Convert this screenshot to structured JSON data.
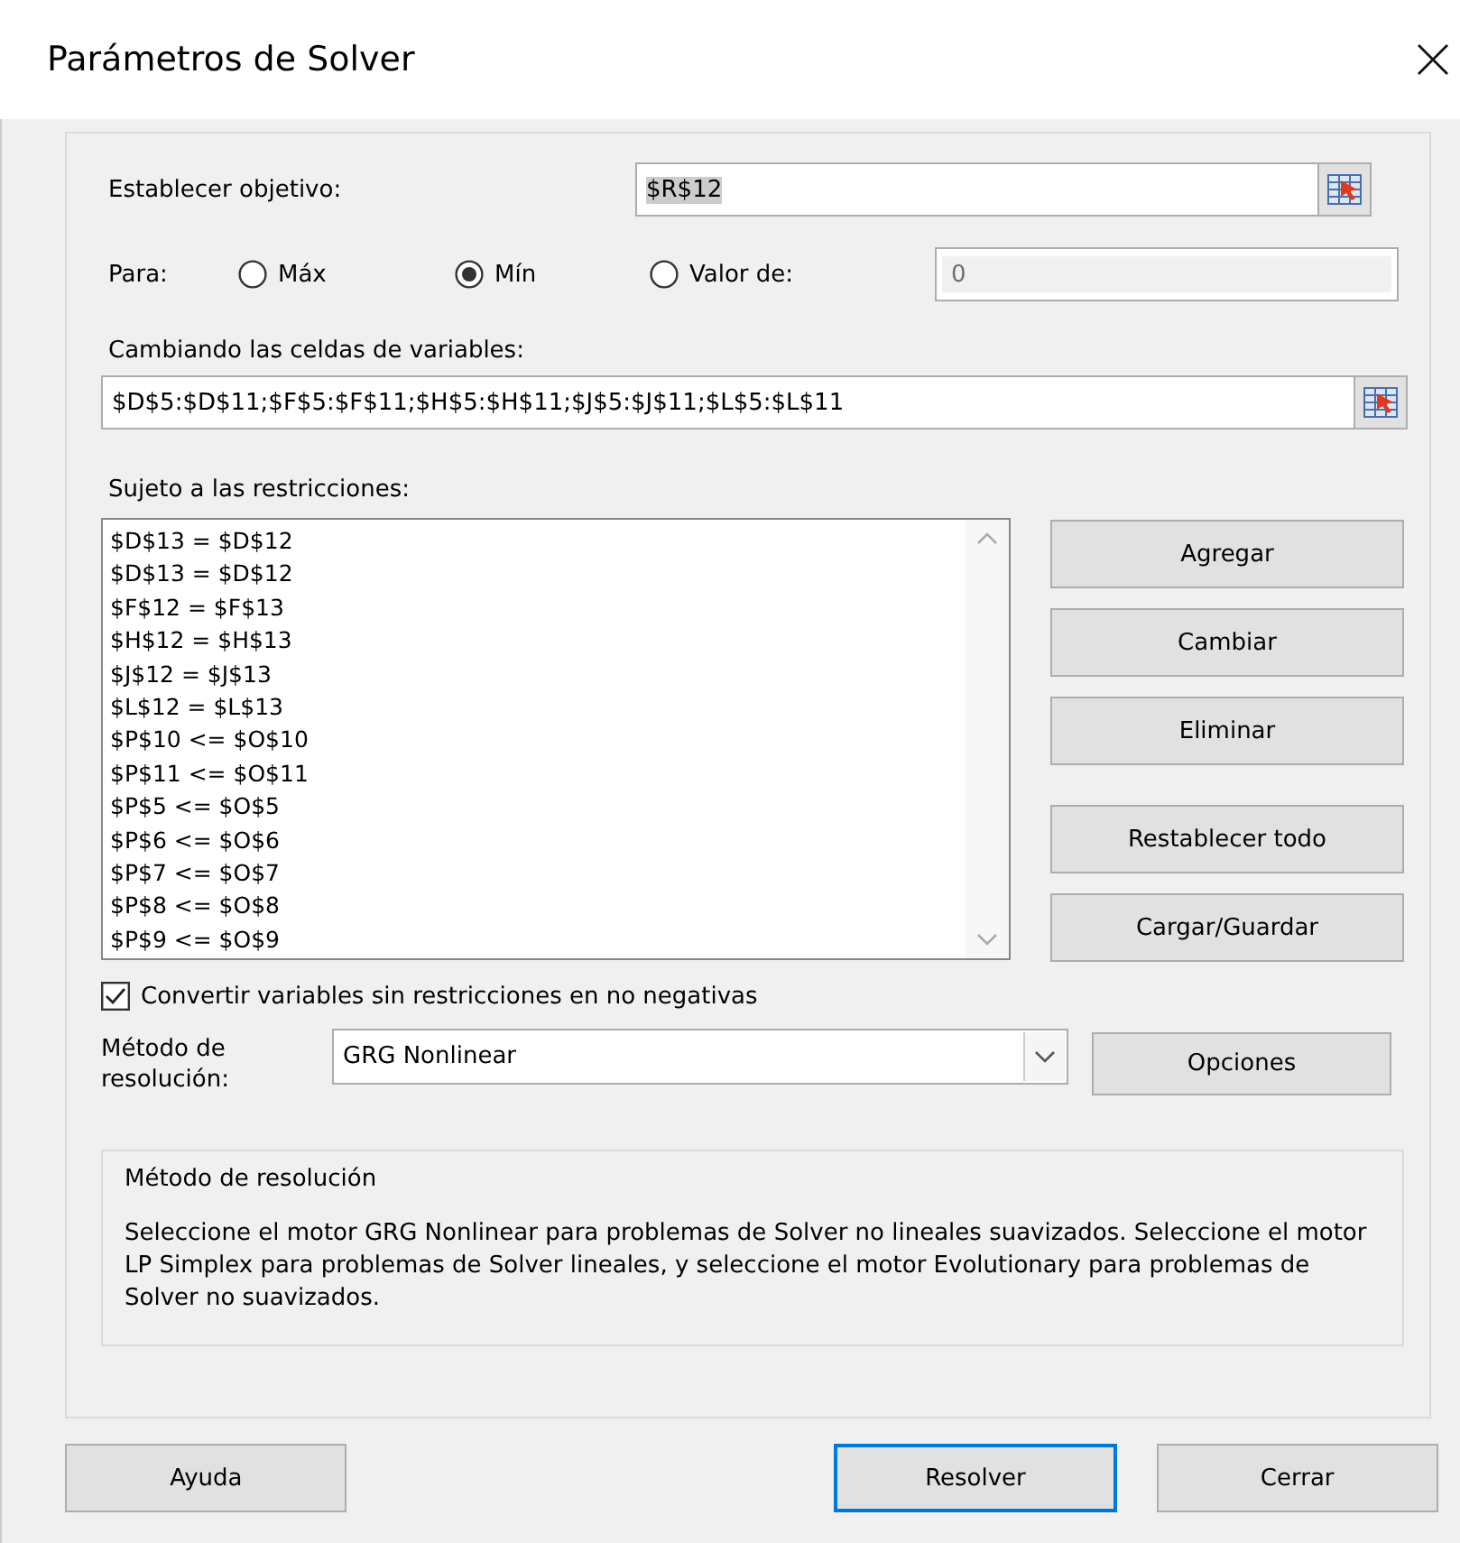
{
  "window": {
    "title": "Parámetros de Solver"
  },
  "objective": {
    "label": "Establecer objetivo:",
    "value": "$R$12"
  },
  "target": {
    "label": "Para:",
    "options": [
      {
        "label": "Máx",
        "selected": false
      },
      {
        "label": "Mín",
        "selected": true
      },
      {
        "label": "Valor de:",
        "selected": false
      }
    ],
    "value_field": {
      "value": "0",
      "disabled": true
    }
  },
  "variables": {
    "label": "Cambiando las celdas de variables:",
    "value": "$D$5:$D$11;$F$5:$F$11;$H$5:$H$11;$J$5:$J$11;$L$5:$L$11"
  },
  "constraints": {
    "label": "Sujeto a las restricciones:",
    "items": [
      "$D$13 = $D$12",
      "$D$13 = $D$12",
      "$F$12 = $F$13",
      "$H$12 = $H$13",
      "$J$12 = $J$13",
      "$L$12 = $L$13",
      "$P$10 <= $O$10",
      "$P$11 <= $O$11",
      "$P$5 <= $O$5",
      "$P$6 <= $O$6",
      "$P$7 <= $O$7",
      "$P$8 <= $O$8",
      "$P$9 <= $O$9"
    ]
  },
  "constraint_buttons": [
    "Agregar",
    "Cambiar",
    "Eliminar",
    "Restablecer todo",
    "Cargar/Guardar"
  ],
  "nonnegative": {
    "label": "Convertir variables sin restricciones en no negativas",
    "checked": true
  },
  "method": {
    "label": "Método de resolución:",
    "value": "GRG Nonlinear",
    "options_button": "Opciones"
  },
  "description": {
    "title": "Método de resolución",
    "text": "Seleccione el motor GRG Nonlinear para problemas de Solver no lineales suavizados. Seleccione el motor LP Simplex para problemas de Solver lineales, y seleccione el motor Evolutionary para problemas de Solver no suavizados."
  },
  "footer_buttons": [
    {
      "label": "Ayuda",
      "default": false
    },
    {
      "label": "Resolver",
      "default": true
    },
    {
      "label": "Cerrar",
      "default": false
    }
  ]
}
